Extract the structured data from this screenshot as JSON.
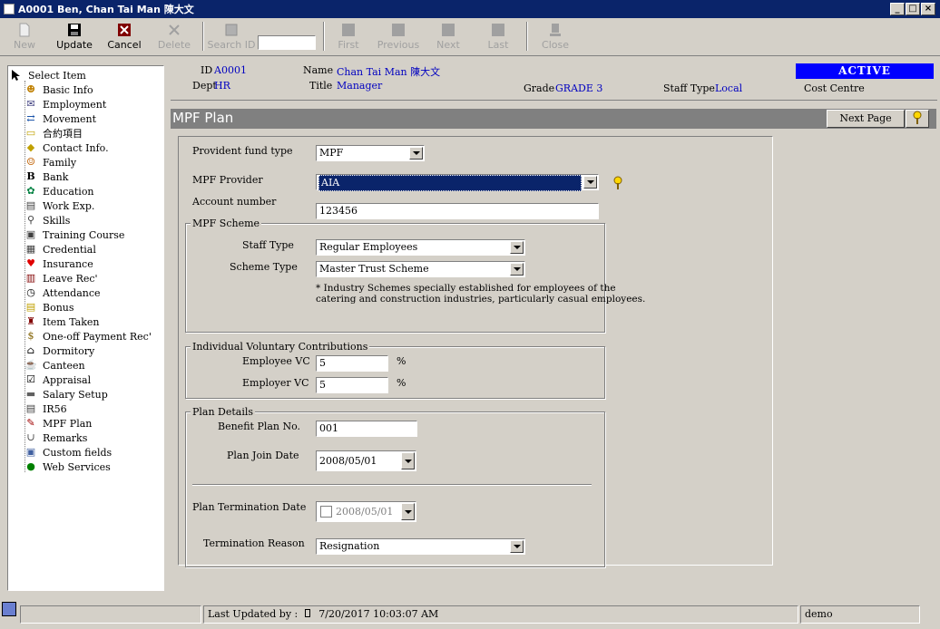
{
  "window": {
    "title": "A0001 Ben, Chan Tai Man 陳大文"
  },
  "toolbar": {
    "new": "New",
    "update": "Update",
    "cancel": "Cancel",
    "delete": "Delete",
    "search_id": "Search ID",
    "first": "First",
    "previous": "Previous",
    "next": "Next",
    "last": "Last",
    "close": "Close"
  },
  "tree": {
    "root": "Select Item",
    "items": [
      {
        "label": "Basic Info",
        "icon": "person-icon"
      },
      {
        "label": "Employment",
        "icon": "envelope-icon"
      },
      {
        "label": "Movement",
        "icon": "movement-icon"
      },
      {
        "label": "合約項目",
        "icon": "folder-icon"
      },
      {
        "label": "Contact Info.",
        "icon": "tag-icon"
      },
      {
        "label": "Family",
        "icon": "family-icon"
      },
      {
        "label": "Bank",
        "icon": "bank-icon"
      },
      {
        "label": "Education",
        "icon": "education-icon"
      },
      {
        "label": "Work Exp.",
        "icon": "document-icon"
      },
      {
        "label": "Skills",
        "icon": "wrench-icon"
      },
      {
        "label": "Training Course",
        "icon": "training-icon"
      },
      {
        "label": "Credential",
        "icon": "credential-icon"
      },
      {
        "label": "Insurance",
        "icon": "heart-icon"
      },
      {
        "label": "Leave Rec'",
        "icon": "calendar-icon"
      },
      {
        "label": "Attendance",
        "icon": "clock-icon"
      },
      {
        "label": "Bonus",
        "icon": "bonus-icon"
      },
      {
        "label": "Item Taken",
        "icon": "item-icon"
      },
      {
        "label": "One-off Payment Rec'",
        "icon": "dollar-icon"
      },
      {
        "label": "Dormitory",
        "icon": "house-icon"
      },
      {
        "label": "Canteen",
        "icon": "canteen-icon"
      },
      {
        "label": "Appraisal",
        "icon": "checklist-icon"
      },
      {
        "label": "Salary Setup",
        "icon": "salary-icon"
      },
      {
        "label": "IR56",
        "icon": "form-icon"
      },
      {
        "label": "MPF Plan",
        "icon": "mpf-icon"
      },
      {
        "label": "Remarks",
        "icon": "paperclip-icon"
      },
      {
        "label": "Custom fields",
        "icon": "custom-icon"
      },
      {
        "label": "Web Services",
        "icon": "globe-icon"
      }
    ]
  },
  "header": {
    "id_label": "ID",
    "id_value": "A0001",
    "name_label": "Name",
    "name_value": "Chan Tai Man  陳大文",
    "dept_label": "Dept",
    "dept_value": "HR",
    "title_label": "Title",
    "title_value": "Manager",
    "grade_label": "Grade",
    "grade_value": "GRADE 3",
    "staff_type_label": "Staff Type",
    "staff_type_value": "Local",
    "cost_centre_label": "Cost Centre",
    "status": "ACTIVE"
  },
  "section": {
    "title": "MPF Plan",
    "next_page": "Next Page"
  },
  "form": {
    "provident_fund_type_label": "Provident fund type",
    "provident_fund_type_value": "MPF",
    "mpf_provider_label": "MPF Provider",
    "mpf_provider_value": "AIA",
    "account_number_label": "Account number",
    "account_number_value": "123456",
    "scheme_group": "MPF Scheme",
    "staff_type_label": "Staff Type",
    "staff_type_value": "Regular Employees",
    "scheme_type_label": "Scheme Type",
    "scheme_type_value": "Master Trust Scheme",
    "note_line1": "* Industry Schemes specially established for employees of the",
    "note_line2": "catering and construction industries, particularly casual employees.",
    "ivc_group": "Individual Voluntary Contributions",
    "employee_vc_label": "Employee VC",
    "employee_vc_value": "5",
    "employer_vc_label": "Employer VC",
    "employer_vc_value": "5",
    "percent": "%",
    "plan_group": "Plan Details",
    "benefit_plan_label": "Benefit Plan No.",
    "benefit_plan_value": "001",
    "plan_join_label": "Plan Join Date",
    "plan_join_value": "2008/05/01",
    "plan_term_label": "Plan Termination Date",
    "plan_term_value": "2008/05/01",
    "term_reason_label": "Termination Reason",
    "term_reason_value": "Resignation"
  },
  "status": {
    "last_updated": "Last Updated by :",
    "last_updated_time": "7/20/2017 10:03:07 AM",
    "user": "demo"
  }
}
